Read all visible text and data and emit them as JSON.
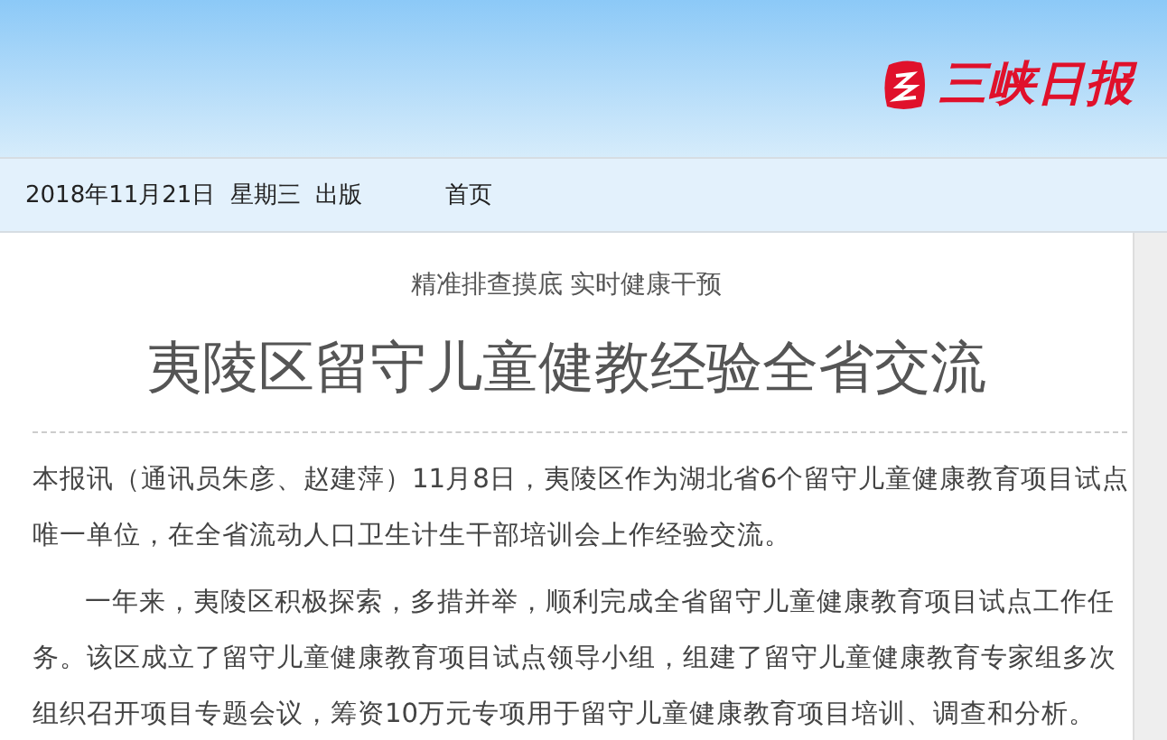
{
  "header": {
    "logo_text": "三峡日报"
  },
  "nav": {
    "date": "2018年11月21日  星期三  出版",
    "links": [
      {
        "label": "首页"
      }
    ]
  },
  "article": {
    "subtitle": "精准排查摸底 实时健康干预",
    "title": "夷陵区留守儿童健教经验全省交流",
    "paragraphs": [
      {
        "text": "本报讯（通讯员朱彦、赵建萍）11月8日，夷陵区作为湖北省6个留守儿童健康教育项目试点唯一单位，在全省流动人口卫生计生干部培训会上作经验交流。",
        "indent": false
      },
      {
        "text": "一年来，夷陵区积极探索，多措并举，顺利完成全省留守儿童健康教育项目试点工作任务。该区成立了留守儿童健康教育项目试点领导小组，组建了留守儿童健康教育专家组多次组织召开项目专题会议，筹资10万元专项用于留守儿童健康教育项目培训、调查和分析。",
        "indent": true
      }
    ]
  }
}
